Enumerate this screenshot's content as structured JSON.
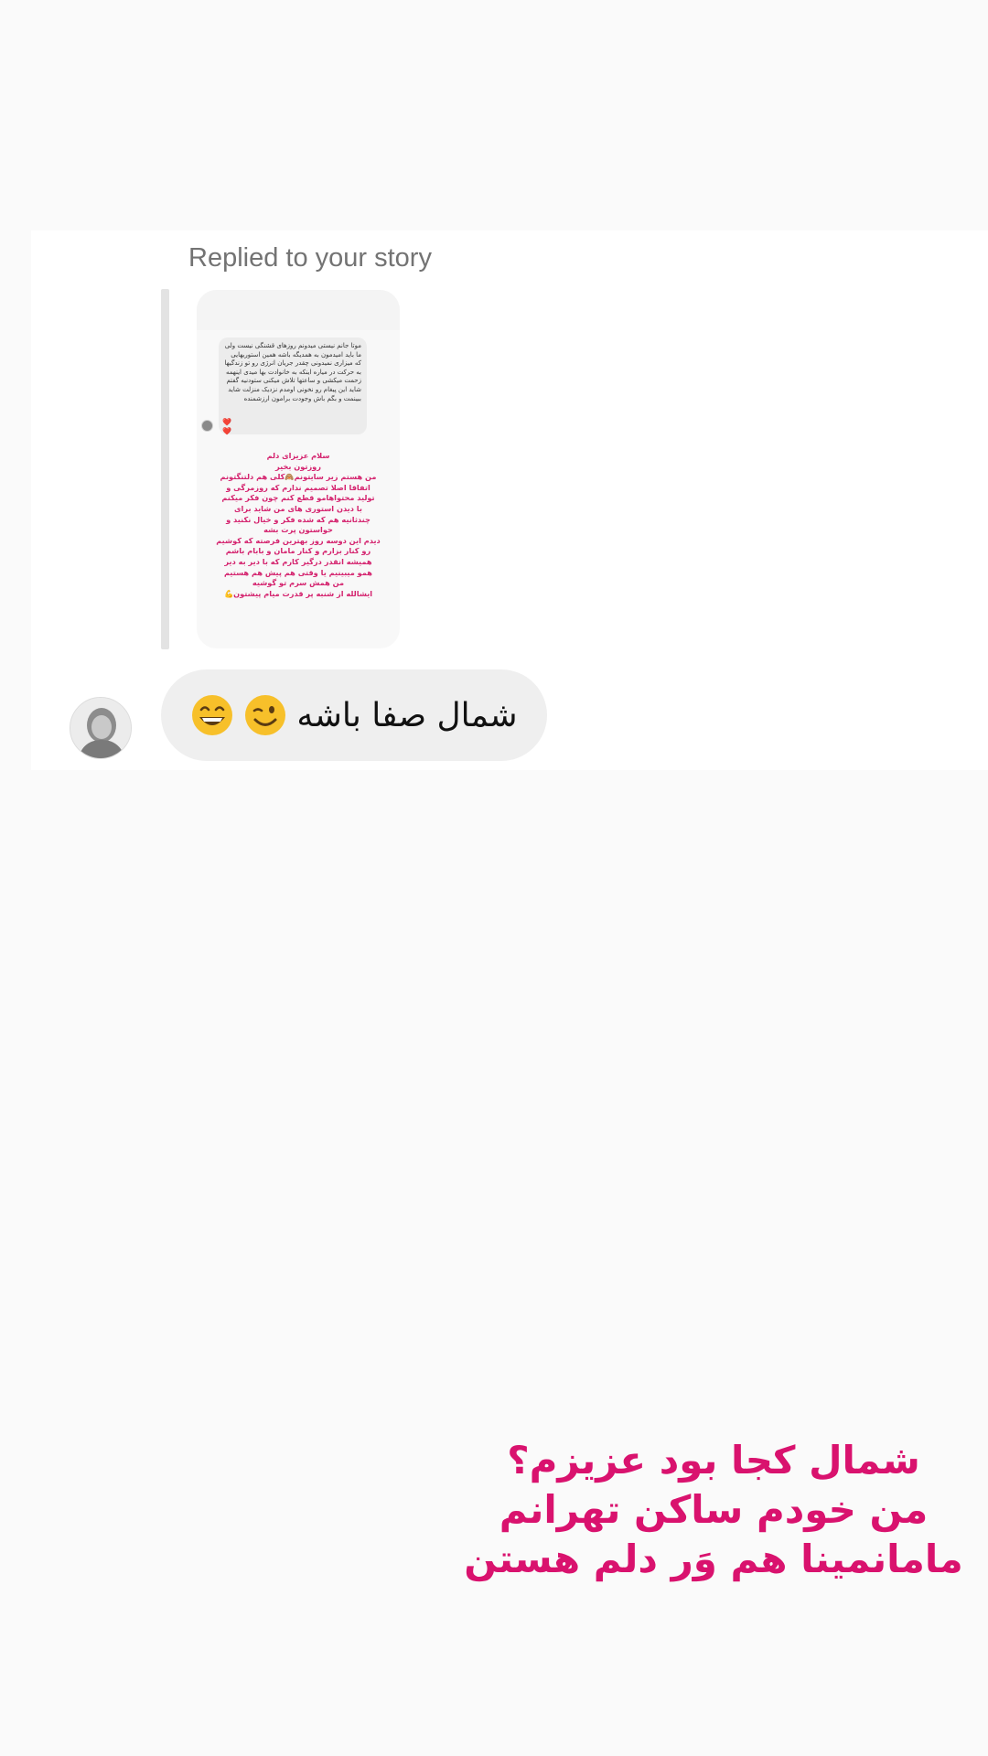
{
  "reply": {
    "label": "Replied to your story"
  },
  "story": {
    "inner_message": "موتا جانم نیستی میدونم روزهای قشنگی نیست ولی ما باید امیدمون به همدیگه باشه همین استوریهایی که میزاری نمیدونی چقدر جریان انرژی رو تو زندگیها به حرکت در میاره اینکه به خانوادت بها میدی اینهمه زحمت میکشی و ساعتها تلاش میکنی ستودنیه گفتم شاید این پیغام رو نخونی اومدم نزدیک منزلت شاید ببینمت و بگم باش وجودت برامون ارزشمنده",
    "inner_hearts": "❤️\n❤️",
    "pink_text": "سلام عزیزای دلم\nروزتون بخیر\nمن هستم زیر سایتونم🙈کلی هم دلتنگتونم\nاتفاقا اصلا تصمیم ندارم که روزمرگی و\nتولید محتواهامو قطع کنم چون فکر میکنم\nبا دیدن استوری های من شاید برای\nچندثانیه هم که شده فکر و خیال نکنید و\nحواستون پرت بشه\nدیدم این دوسه روز بهترین فرصته که کوشیم\nرو کنار بزارم و  کنار مامان و بابام باشم\nهمیشه انقدر درگیر کارم که با دیر به دیر\nهمو میبینیم یا وقتی هم پیش هم هستیم\nمن همش سرم تو گوشیه\nایشالله از شنبه پر قدرت میام پیشتون💪"
  },
  "message": {
    "text": "شمال صفا باشه",
    "emojis": [
      "winking-face-icon",
      "grinning-face-icon"
    ]
  },
  "caption": {
    "line1": "شمال کجا بود عزیزم؟",
    "line2": "من خودم ساکن تهرانم",
    "line3": "مامانمینا هم وَر دلم هستن"
  },
  "colors": {
    "caption": "#d9126e",
    "pink_story_text": "#d4236e",
    "bubble_bg": "#efefef",
    "label_gray": "#737373"
  }
}
